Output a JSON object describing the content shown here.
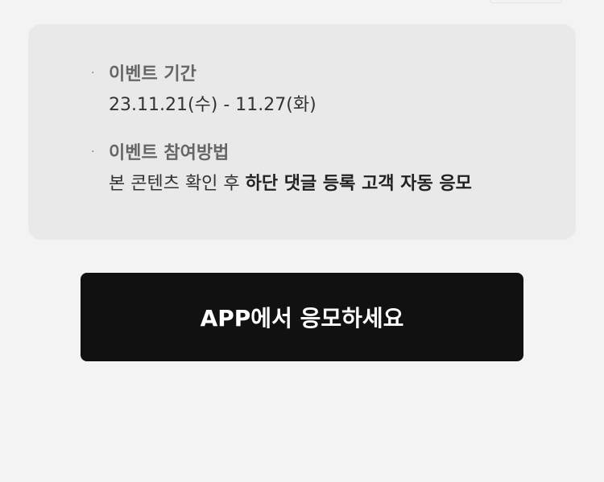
{
  "event_info": {
    "period": {
      "bullet": "·",
      "title": "이벤트 기간",
      "value": "23.11.21(수) - 11.27(화)"
    },
    "method": {
      "bullet": "·",
      "title": "이벤트 참여방법",
      "value_plain": "본 콘텐츠 확인 후 ",
      "value_emphasis": "하단 댓글 등록 고객 자동 응모"
    }
  },
  "cta": {
    "label": "APP에서 응모하세요"
  },
  "colors": {
    "page_bg": "#f3f3f3",
    "box_bg": "#e9e9e9",
    "button_bg": "#111111",
    "button_text": "#ffffff"
  }
}
